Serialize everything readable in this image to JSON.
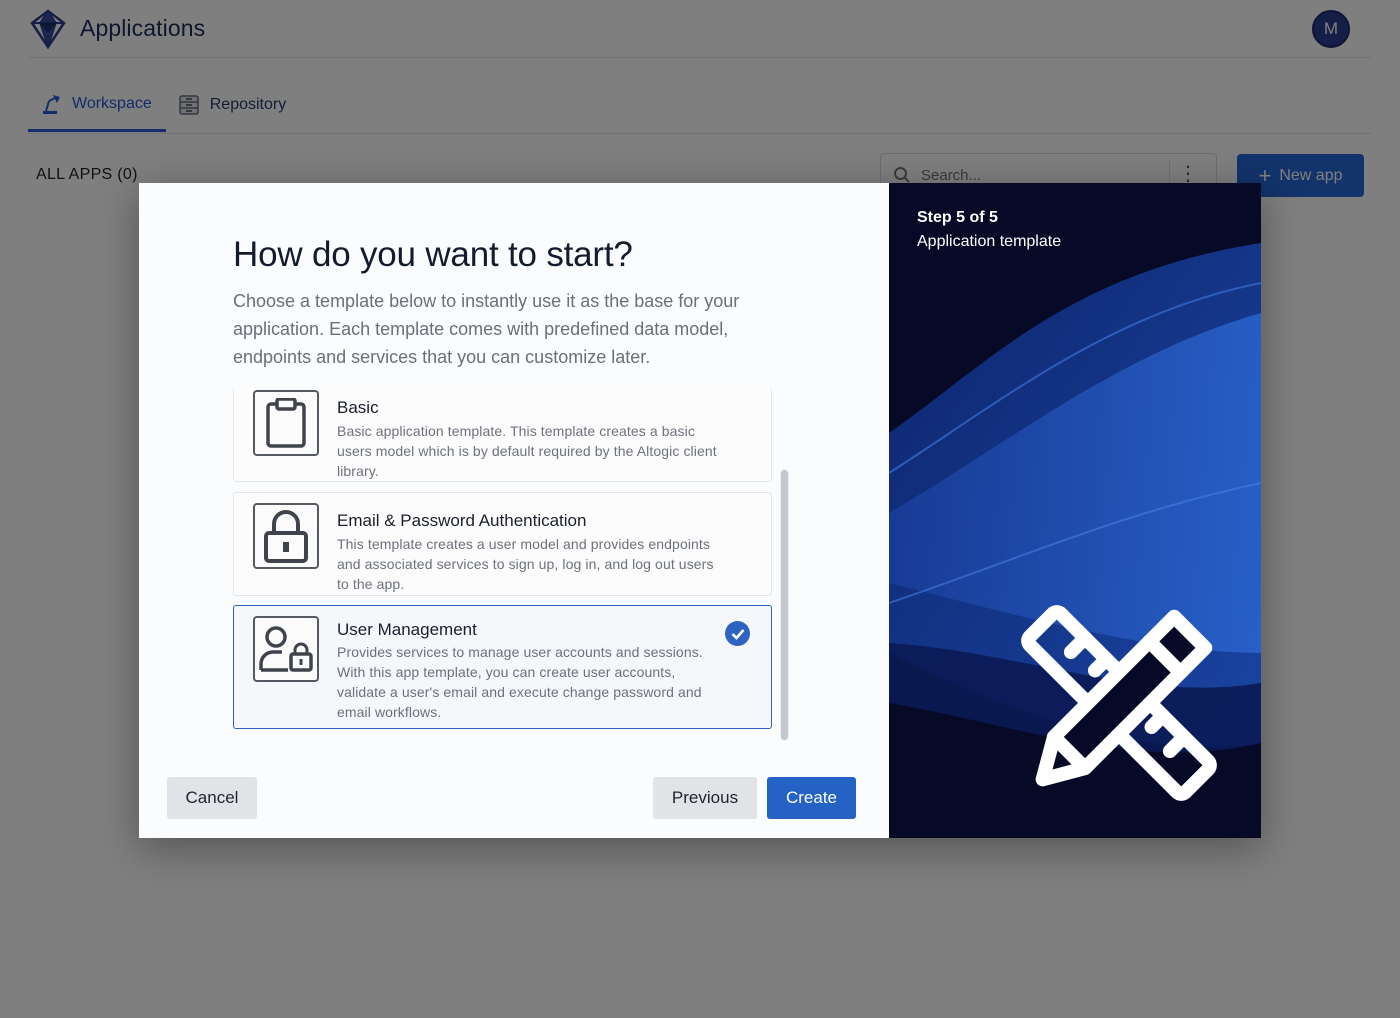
{
  "app": {
    "title": "Applications",
    "avatar_initial": "M",
    "brand_color": "#1d2c5a"
  },
  "tabs": [
    {
      "label": "Workspace",
      "icon": "workspace-lamp-icon",
      "active": true
    },
    {
      "label": "Repository",
      "icon": "repository-cabinet-icon",
      "active": false
    }
  ],
  "apps_list": {
    "header": "ALL APPS (0)",
    "search_placeholder": "Search...",
    "new_app_label": "New app"
  },
  "modal": {
    "heading": "How do you want to start?",
    "description": "Choose a template below to instantly use it as the base for your application. Each template comes with predefined data model, endpoints and services that you can customize later.",
    "templates": [
      {
        "title": "Basic",
        "description": "Basic application template. This template creates a basic users model which is by default required by the Altogic client library.",
        "icon": "clipboard-icon",
        "selected": false
      },
      {
        "title": "Email & Password Authentication",
        "description": "This template creates a user model and provides endpoints and associated services to sign up, log in, and log out users to the app.",
        "icon": "lock-icon",
        "selected": false
      },
      {
        "title": "User Management",
        "description": "Provides services to manage user accounts and sessions. With this app template, you can create user accounts, validate a user's email and execute change password and email workflows.",
        "icon": "user-lock-icon",
        "selected": true
      }
    ],
    "buttons": {
      "cancel": "Cancel",
      "previous": "Previous",
      "create": "Create"
    },
    "side_panel": {
      "step": "Step 5 of 5",
      "step_name": "Application template",
      "icon": "ruler-pencil-icon"
    },
    "accent_color": "#2463c5"
  }
}
